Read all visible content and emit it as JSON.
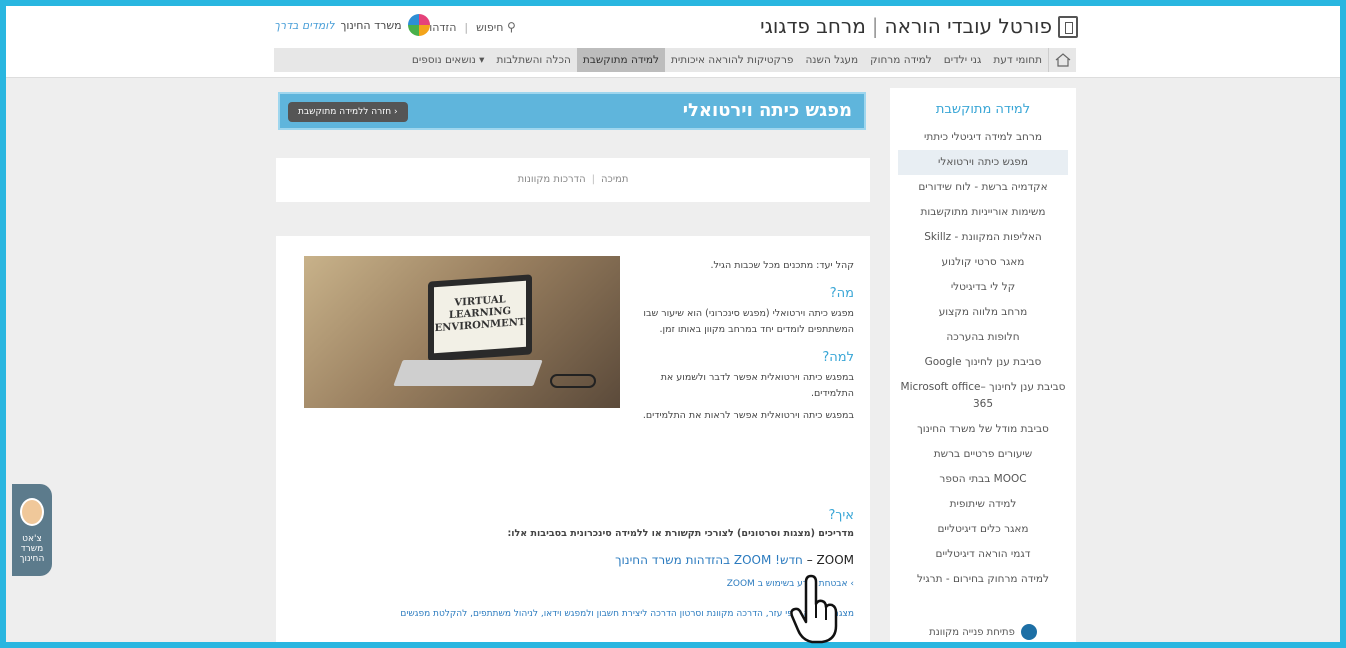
{
  "header": {
    "portal_name": "פורטל עובדי הוראה",
    "portal_sub": "מרחב פדגוגי",
    "search_label": "חיפוש",
    "login_label": "הזדהות",
    "ministry_label": "משרד החינוך",
    "logo_script": "לומדים בדרך"
  },
  "nav": {
    "items": [
      "תחומי דעת",
      "גני ילדים",
      "למידה מרחוק",
      "מעגל השנה",
      "פרקטיקות להוראה איכותית",
      "למידה מתוקשבת",
      "הכלה והשתלבות",
      "נושאים נוספים ▾"
    ],
    "active_index": 5
  },
  "sidebar": {
    "heading": "למידה מתוקשבת",
    "links": [
      "מרחב למידה דיגיטלי כיתתי",
      "מפגש כיתה וירטואלי",
      "אקדמיה ברשת - לוח שידורים",
      "משימות אורייניות מתוקשבות",
      "האליפות המקוונת - Skillz",
      "מאגר סרטי קולנוע",
      "קל לי בדיגיטלי",
      "מרחב מלווה מקצוע",
      "חלופות בהערכה",
      "סביבת ענן לחינוך Google",
      "סביבת ענן לחינוך –Microsoft office 365",
      "סביבת מודל של משרד החינוך",
      "שיעורים פרטיים ברשת",
      "MOOC בבתי הספר",
      "למידה שיתופית",
      "מאגר כלים דיגיטליים",
      "דגמי הוראה דיגיטליים",
      "למידה מרחוק בחירום - תרגיל"
    ],
    "active_index": 1,
    "bottom": "פתיחת פנייה מקוונת"
  },
  "page": {
    "title": "מפגש כיתה וירטואלי",
    "back_button": "חזרה ללמידה מתוקשבת ›",
    "tab_guides": "הדרכות מקוונות",
    "tab_support": "תמיכה"
  },
  "content": {
    "audience": "קהל יעד: מתכנים מכל שכבות הגיל.",
    "what_title": "מה?",
    "what_text": "מפגש כיתה וירטואלי (מפגש סינכרוני) הוא שיעור שבו המשתתפים לומדים יחד במרחב מקוון באותו זמן.",
    "why_title": "למה?",
    "why_text1": "במפגש כיתה וירטואלית אפשר לדבר ולשמוע את התלמידים.",
    "why_text2": "במפגש כיתה וירטואלית אפשר לראות את התלמידים.",
    "image_text": "VIRTUAL LEARNING ENVIRONMENT",
    "how_title": "איך?",
    "how_text": "מדריכים (מצגות וסרטונים) לצורכי תקשורת או ללמידה סינכרונית בסביבות אלו:",
    "zoom_label": "ZOOM –",
    "zoom_link": "חדש! ZOOM בהזדהות משרד החינוך",
    "zoom_sub": "› אבטחת מידע בשימוש ב ZOOM",
    "cut_text": "מצגת הדרכה, דפי עזר, הדרכה מקוונת וסרטון הדרכה ליצירת חשבון ולמפגש וידאו, לניהול משתתפים, להקלטת מפגשים",
    "cut_end": "להקלטת"
  },
  "chat_tab": {
    "label": "צ'אט משרד החינוך"
  },
  "colors": {
    "frame": "#29b6e0",
    "accent": "#39a6d6",
    "header_bar": "#5fb5dc"
  }
}
